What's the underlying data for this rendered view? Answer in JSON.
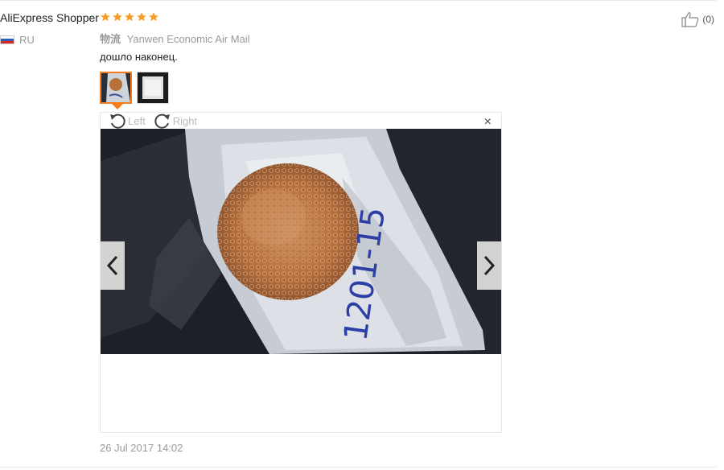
{
  "review": {
    "buyer_name": "AliExpress Shopper",
    "rating": 5,
    "country": "RU",
    "shipping_label": "物流",
    "shipping_method": "Yanwen Economic Air Mail",
    "text": "дошло наконец.",
    "date": "26 Jul 2017 14:02",
    "helpful_count": "(0)"
  },
  "viewer": {
    "rotate_left_label": "Left",
    "rotate_right_label": "Right",
    "close_symbol": "×",
    "photo_label": "1201-15"
  },
  "colors": {
    "star": "#f89b24",
    "thumb_selected_border": "#f57d20"
  },
  "icons": {
    "rating": "star-icon",
    "flag": "russia-flag-icon",
    "helpful": "thumbs-up-icon",
    "rotate_left": "rotate-left-icon",
    "rotate_right": "rotate-right-icon",
    "close": "close-icon",
    "prev": "chevron-left-icon",
    "next": "chevron-right-icon"
  }
}
